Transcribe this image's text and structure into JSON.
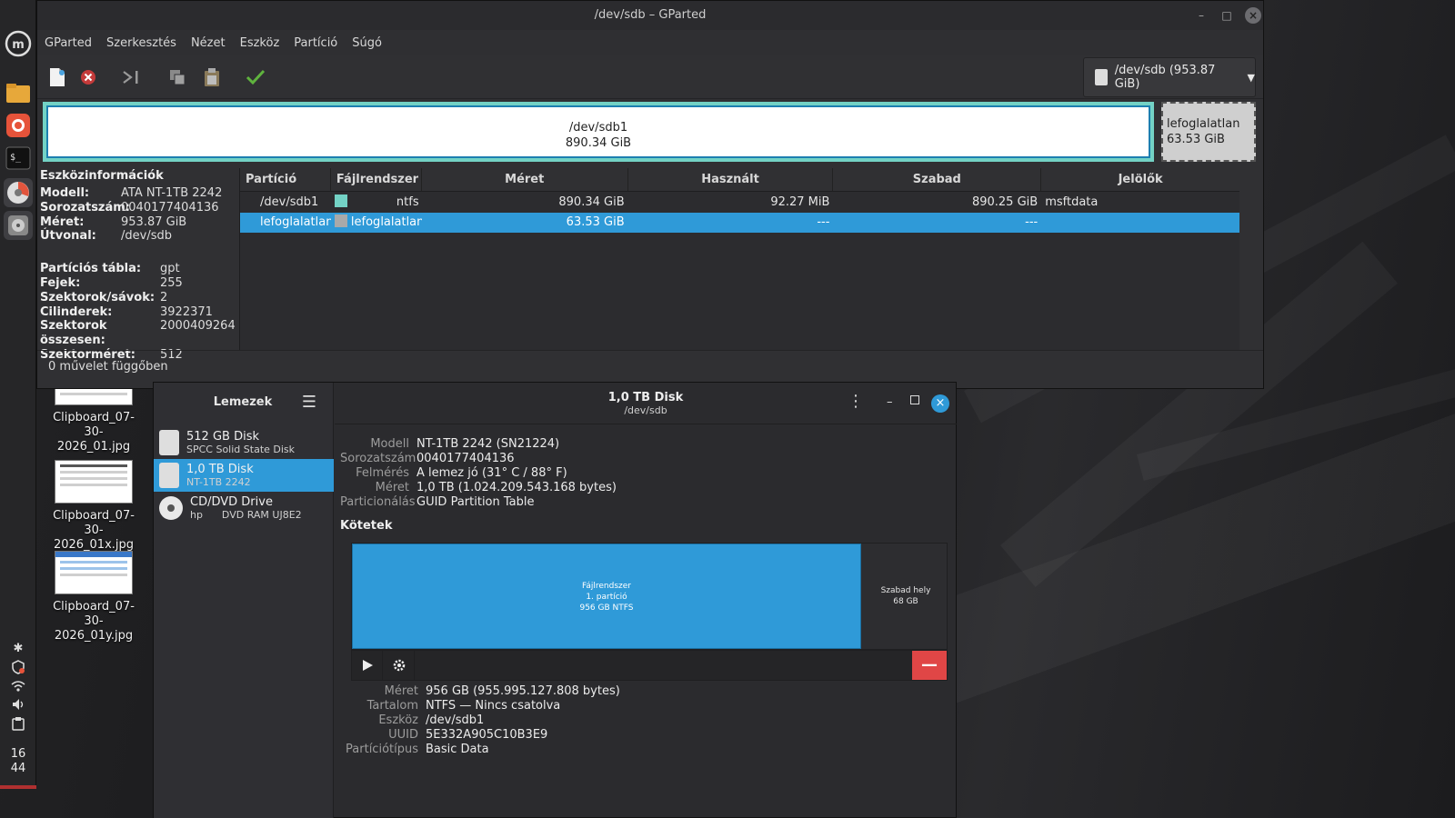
{
  "panel": {
    "tray_bluetooth": "✱",
    "clock_hour": "16",
    "clock_minute": "44"
  },
  "desktop_files": [
    {
      "line1": "Clipboard_07-30-",
      "line2": "2026_01.jpg"
    },
    {
      "line1": "Clipboard_07-30-",
      "line2": "2026_01x.jpg"
    },
    {
      "line1": "Clipboard_07-30-",
      "line2": "2026_01y.jpg"
    }
  ],
  "gparted": {
    "title": "/dev/sdb – GParted",
    "menu": [
      "GParted",
      "Szerkesztés",
      "Nézet",
      "Eszköz",
      "Partíció",
      "Súgó"
    ],
    "device_select": "/dev/sdb (953.87 GiB)",
    "graphic": {
      "sdb1_name": "/dev/sdb1",
      "sdb1_size": "890.34 GiB",
      "unalloc_name": "lefoglalatlan",
      "unalloc_size": "63.53 GiB"
    },
    "info": {
      "heading": "Eszközinformációk",
      "basic": [
        {
          "k": "Modell:",
          "v": "ATA NT-1TB 2242"
        },
        {
          "k": "Sorozatszám:",
          "v": "0040177404136"
        },
        {
          "k": "Méret:",
          "v": "953.87 GiB"
        },
        {
          "k": "Útvonal:",
          "v": "/dev/sdb"
        }
      ],
      "geometry": [
        {
          "k": "Partíciós tábla:",
          "v": "gpt"
        },
        {
          "k": "Fejek:",
          "v": "255"
        },
        {
          "k": "Szektorok/sávok:",
          "v": "2"
        },
        {
          "k": "Cilinderek:",
          "v": "3922371"
        },
        {
          "k": "Szektorok összesen:",
          "v": "2000409264"
        },
        {
          "k": "Szektorméret:",
          "v": "512"
        }
      ]
    },
    "table": {
      "headers": [
        "Partíció",
        "Fájlrendszer",
        "Méret",
        "Használt",
        "Szabad",
        "Jelölők"
      ],
      "rows": [
        {
          "partition": "/dev/sdb1",
          "fs": "ntfs",
          "fs_color": "#73d2c5",
          "size": "890.34 GiB",
          "used": "92.27 MiB",
          "free": "890.25 GiB",
          "flags": "msftdata"
        },
        {
          "partition": "lefoglalatlan",
          "fs": "lefoglalatlan",
          "fs_color": "#a9a9a9",
          "size": "63.53 GiB",
          "used": "---",
          "free": "---",
          "flags": ""
        }
      ]
    },
    "status": "0 művelet függőben"
  },
  "disks": {
    "sidebar_title": "Lemezek",
    "drives": [
      {
        "name": "512 GB Disk",
        "desc": "SPCC Solid State Disk"
      },
      {
        "name": "1,0 TB Disk",
        "desc": "NT-1TB 2242"
      },
      {
        "name": "CD/DVD Drive",
        "desc": "hp      DVD RAM UJ8E2"
      }
    ],
    "title": "1,0 TB Disk",
    "subtitle": "/dev/sdb",
    "drive_info": [
      {
        "k": "Modell",
        "v": "NT-1TB 2242 (SN21224)"
      },
      {
        "k": "Sorozatszám",
        "v": "0040177404136"
      },
      {
        "k": "Felmérés",
        "v": "A lemez jó (31° C / 88° F)"
      },
      {
        "k": "Méret",
        "v": "1,0 TB (1.024.209.543.168 bytes)"
      },
      {
        "k": "Particionálás",
        "v": "GUID Partition Table"
      }
    ],
    "volumes_title": "Kötetek",
    "volume": {
      "line1": "Fájlrendszer",
      "line2": "1. partíció",
      "line3": "956 GB NTFS"
    },
    "free_space": {
      "line1": "Szabad hely",
      "line2": "68 GB"
    },
    "volume_info": [
      {
        "k": "Méret",
        "v": "956 GB (955.995.127.808 bytes)"
      },
      {
        "k": "Tartalom",
        "v": "NTFS — Nincs csatolva"
      },
      {
        "k": "Eszköz",
        "v": "/dev/sdb1"
      },
      {
        "k": "UUID",
        "v": "5E332A905C10B3E9"
      },
      {
        "k": "Partíciótípus",
        "v": "Basic Data"
      }
    ]
  }
}
